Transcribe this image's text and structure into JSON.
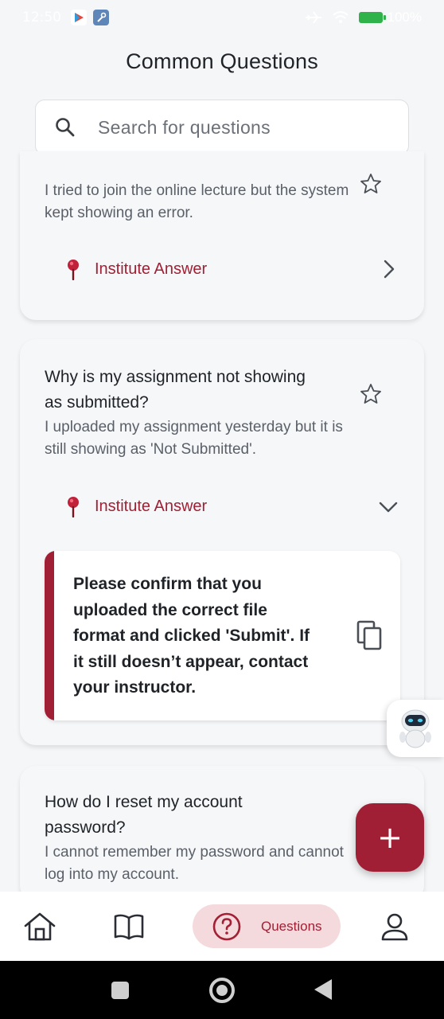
{
  "status_bar": {
    "time": "12:50",
    "battery": "100%"
  },
  "page": {
    "title": "Common Questions"
  },
  "search": {
    "placeholder": "Search for questions"
  },
  "questions": [
    {
      "title": "",
      "description": "I tried to join the online lecture but the system kept showing an error.",
      "answer_label": "Institute Answer",
      "expanded": false
    },
    {
      "title": "Why is my assignment not showing as submitted?",
      "description": "I uploaded my assignment yesterday but it is still showing as 'Not Submitted'.",
      "answer_label": "Institute Answer",
      "expanded": true,
      "answer": "Please confirm that you uploaded the correct file format and clicked 'Submit'. If it still doesn’t appear, contact your instructor."
    },
    {
      "title": "How do I reset my account password?",
      "description": "I cannot remember my password and cannot log into my account."
    }
  ],
  "fab": {
    "icon": "plus-icon",
    "label": "+"
  },
  "bottom_nav": {
    "items": [
      {
        "icon": "home-icon"
      },
      {
        "icon": "book-icon"
      },
      {
        "icon": "question-icon",
        "label": "Questions",
        "active": true
      },
      {
        "icon": "profile-icon"
      }
    ]
  },
  "colors": {
    "accent": "#a01f35",
    "active_pill": "#f4d9dd",
    "background": "#f5f6f8"
  }
}
